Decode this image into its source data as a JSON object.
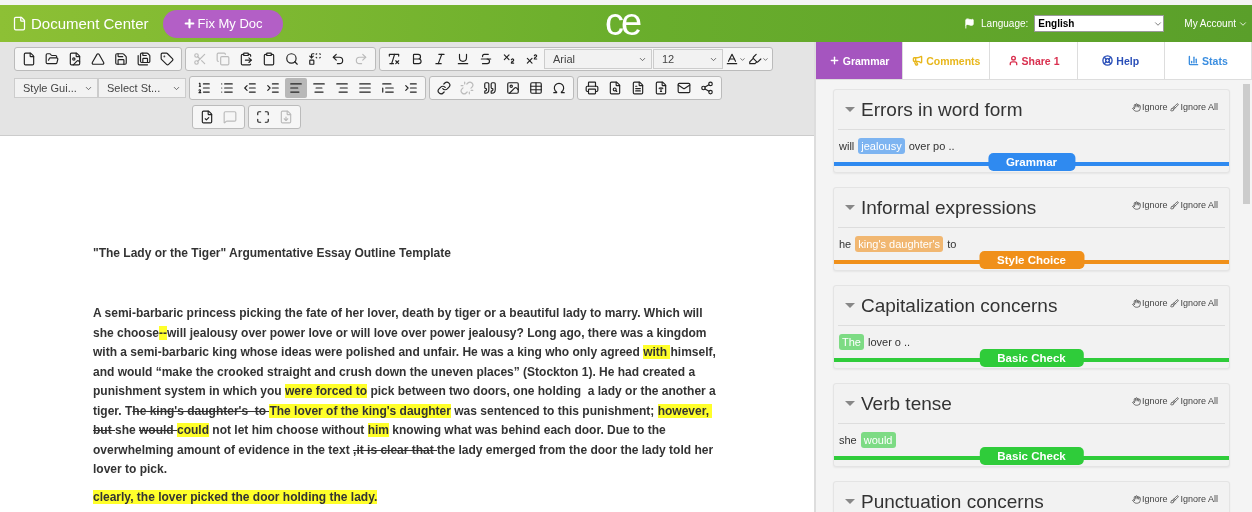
{
  "header": {
    "title": "Document Center",
    "fix_button": "Fix My Doc",
    "logo": "ce",
    "language_label": "Language:",
    "language_value": "English",
    "account": "My Account"
  },
  "toolbar": {
    "rows": [
      {
        "groups": [
          {
            "buttons": [
              {
                "kind": "new",
                "disabled": false,
                "selected": false
              },
              {
                "kind": "open",
                "disabled": false,
                "selected": false
              },
              {
                "kind": "template",
                "disabled": false,
                "selected": false
              },
              {
                "kind": "drive",
                "disabled": false,
                "selected": false
              },
              {
                "kind": "save",
                "disabled": false,
                "selected": false
              },
              {
                "kind": "saveas",
                "disabled": false,
                "selected": false
              },
              {
                "kind": "tag",
                "disabled": false,
                "selected": false
              }
            ]
          },
          {
            "buttons": [
              {
                "kind": "cut",
                "disabled": true,
                "selected": false
              },
              {
                "kind": "copy",
                "disabled": true,
                "selected": false
              },
              {
                "kind": "paste",
                "disabled": false,
                "selected": false
              },
              {
                "kind": "pasteword",
                "disabled": false,
                "selected": false
              },
              {
                "kind": "find",
                "disabled": false,
                "selected": false
              },
              {
                "kind": "replace",
                "disabled": false,
                "selected": false
              },
              {
                "kind": "undo",
                "disabled": false,
                "selected": false
              },
              {
                "kind": "redo",
                "disabled": true,
                "selected": false
              }
            ]
          },
          {
            "buttons": [
              {
                "kind": "clearformat",
                "disabled": false,
                "selected": false
              },
              {
                "kind": "bold",
                "disabled": false,
                "selected": false
              },
              {
                "kind": "italic",
                "disabled": false,
                "selected": false
              },
              {
                "kind": "underline",
                "disabled": false,
                "selected": false
              },
              {
                "kind": "strike",
                "disabled": false,
                "selected": false
              },
              {
                "kind": "subscript",
                "disabled": false,
                "selected": false
              },
              {
                "kind": "superscript",
                "disabled": false,
                "selected": false
              }
            ],
            "selects": [
              {
                "value": "Arial"
              },
              {
                "value": "12"
              }
            ],
            "extras": [
              {
                "kind": "textcolor"
              },
              {
                "kind": "bgcolor"
              }
            ]
          }
        ]
      },
      {
        "selects": [
          {
            "value": "Style Gui..."
          },
          {
            "value": "Select St..."
          }
        ],
        "groups": [
          {
            "buttons": [
              {
                "kind": "numbered",
                "disabled": false,
                "selected": false
              },
              {
                "kind": "bulleted",
                "disabled": false,
                "selected": false
              },
              {
                "kind": "outdent",
                "disabled": false,
                "selected": false
              },
              {
                "kind": "indent",
                "disabled": false,
                "selected": false
              },
              {
                "kind": "alignleft",
                "disabled": false,
                "selected": true
              },
              {
                "kind": "aligncenter",
                "disabled": false,
                "selected": false
              },
              {
                "kind": "alignright",
                "disabled": false,
                "selected": false
              },
              {
                "kind": "justify",
                "disabled": false,
                "selected": false
              },
              {
                "kind": "lines",
                "disabled": false,
                "selected": false
              },
              {
                "kind": "blockindent",
                "disabled": false,
                "selected": false
              }
            ]
          },
          {
            "buttons": [
              {
                "kind": "link",
                "disabled": false,
                "selected": false
              },
              {
                "kind": "unlink",
                "disabled": true,
                "selected": false
              },
              {
                "kind": "quote",
                "disabled": false,
                "selected": false
              },
              {
                "kind": "image",
                "disabled": false,
                "selected": false
              },
              {
                "kind": "table",
                "disabled": false,
                "selected": false
              },
              {
                "kind": "symbol",
                "disabled": false,
                "selected": false
              }
            ]
          },
          {
            "buttons": [
              {
                "kind": "print",
                "disabled": false,
                "selected": false
              },
              {
                "kind": "preview",
                "disabled": false,
                "selected": false
              },
              {
                "kind": "document",
                "disabled": false,
                "selected": false
              },
              {
                "kind": "pdf",
                "disabled": false,
                "selected": false
              },
              {
                "kind": "email",
                "disabled": false,
                "selected": false
              },
              {
                "kind": "share",
                "disabled": false,
                "selected": false
              }
            ]
          }
        ]
      },
      {
        "groups": [
          {
            "buttons": [
              {
                "kind": "review",
                "disabled": false,
                "selected": false
              },
              {
                "kind": "comment",
                "disabled": true,
                "selected": false
              }
            ]
          },
          {
            "buttons": [
              {
                "kind": "fullscreen",
                "disabled": false,
                "selected": false
              },
              {
                "kind": "download",
                "disabled": true,
                "selected": false
              }
            ]
          }
        ]
      }
    ]
  },
  "document": {
    "title": "\"The Lady or the Tiger\" Argumentative Essay Outline Template",
    "paragraphs": [
      {
        "segments": [
          {
            "text": "A semi-barbaric princess picking the fate of her lover, death by tiger or a beautiful lady to marry. Which will she choose",
            "highlight": false,
            "strike": false
          },
          {
            "text": "--",
            "highlight": true,
            "strike": false
          },
          {
            "text": "will jealousy over power love or will love over power jealousy? Long ago, there was a kingdom with a semi-barbaric king whose ideas were polished and unfair. He was a king who only agreed ",
            "highlight": false,
            "strike": false
          },
          {
            "text": "with ",
            "highlight": true,
            "strike": false
          },
          {
            "text": "himself, and would “make the crooked straight and crush down the uneven places” (Stockton 1). He had created a punishment system in which you ",
            "highlight": false,
            "strike": false
          },
          {
            "text": "were forced to",
            "highlight": true,
            "strike": false
          },
          {
            "text": " pick between two doors, one holding  a lady or the another a tiger. T",
            "highlight": false,
            "strike": false
          },
          {
            "text": "he king's daughter's  to ",
            "highlight": false,
            "strike": true
          },
          {
            "text": "The lover of the king's daughter",
            "highlight": true,
            "strike": false
          },
          {
            "text": " was sentenced to this punishment; ",
            "highlight": false,
            "strike": false
          },
          {
            "text": "however, ",
            "highlight": true,
            "strike": false
          },
          {
            "text": "but ",
            "highlight": false,
            "strike": true
          },
          {
            "text": "she ",
            "highlight": false,
            "strike": false
          },
          {
            "text": "would ",
            "highlight": false,
            "strike": true
          },
          {
            "text": "could",
            "highlight": true,
            "strike": false
          },
          {
            "text": " not let him choose without ",
            "highlight": false,
            "strike": false
          },
          {
            "text": "him",
            "highlight": true,
            "strike": false
          },
          {
            "text": " knowing what was behind each door. Due to the overwhelming amount of evidence in the text ",
            "highlight": false,
            "strike": false
          },
          {
            "text": ",it is clear that ",
            "highlight": false,
            "strike": true
          },
          {
            "text": "the lady emerged from the door the lady told her lover to pick.",
            "highlight": false,
            "strike": false
          }
        ]
      },
      {
        "segments": [
          {
            "text": "clearly, the lover picked the door holding the lady.",
            "highlight": true,
            "strike": false
          }
        ]
      }
    ]
  },
  "panel": {
    "tabs": [
      {
        "label": "Grammar",
        "color": "#a555bf",
        "selected": true
      },
      {
        "label": "Comments",
        "color": "#e8b71c",
        "selected": false
      },
      {
        "label": "Share 1",
        "color": "#d9304f",
        "selected": false
      },
      {
        "label": "Help",
        "color": "#2a4fb8",
        "selected": false
      },
      {
        "label": "Stats",
        "color": "#3b8ee0",
        "selected": false
      }
    ],
    "cards": [
      {
        "title": "Errors in word form",
        "ignore": "Ignore",
        "ignore_all": "Ignore All",
        "before": "will",
        "match": "jealousy",
        "after": "over po ..",
        "category": "Grammar",
        "color": "#2f8af0"
      },
      {
        "title": "Informal expressions",
        "ignore": "Ignore",
        "ignore_all": "Ignore All",
        "before": "he",
        "match": "king's daughter's",
        "after": "to",
        "category": "Style Choice",
        "color": "#f0901a"
      },
      {
        "title": "Capitalization concerns",
        "ignore": "Ignore",
        "ignore_all": "Ignore All",
        "match": "The",
        "after": "lover o ..",
        "category": "Basic Check",
        "color": "#2fcc3a"
      },
      {
        "title": "Verb tense",
        "ignore": "Ignore",
        "ignore_all": "Ignore All",
        "before": "she",
        "match": "would",
        "category": "Basic Check",
        "color": "#2fcc3a"
      },
      {
        "title": "Punctuation concerns",
        "ignore": "Ignore",
        "ignore_all": "Ignore All"
      }
    ]
  }
}
